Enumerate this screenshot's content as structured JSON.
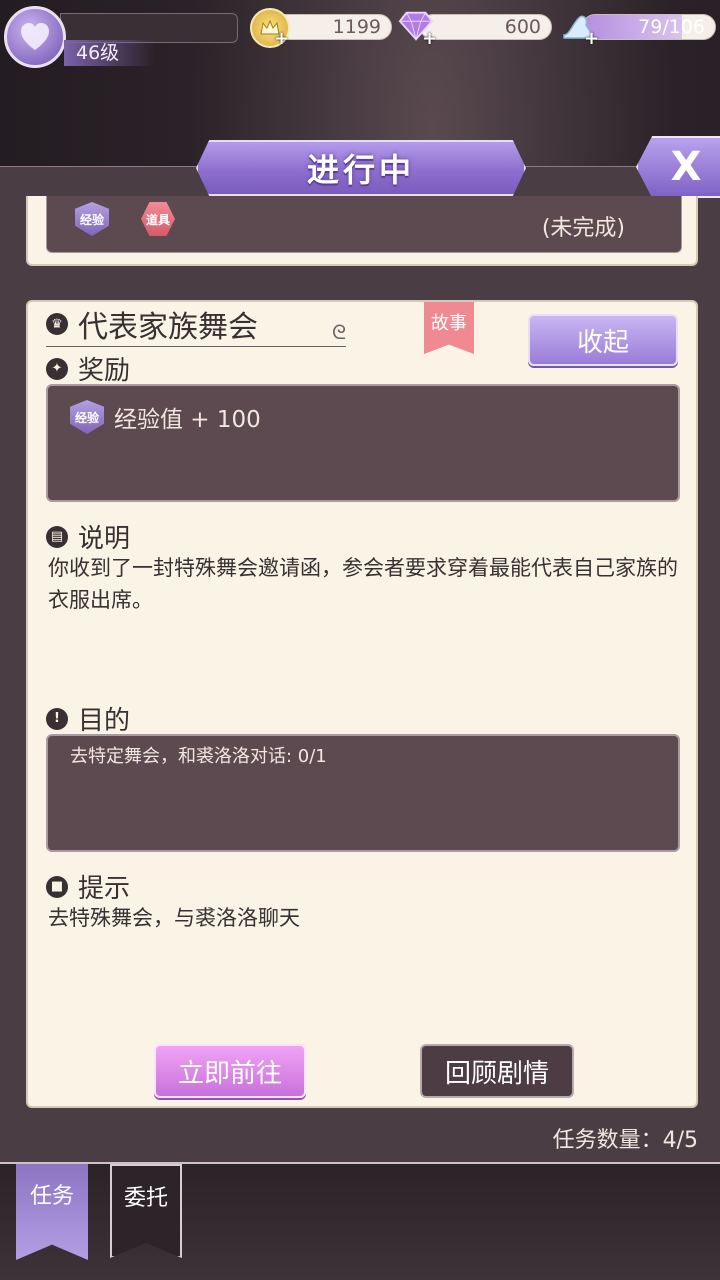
{
  "top_bar": {
    "level": "46级",
    "gold": "1199",
    "diamonds": "600",
    "energy": "79/106",
    "energy_fill": 0.745,
    "plus": "+"
  },
  "header": {
    "title": "进行中",
    "close": "X"
  },
  "prev_quest": {
    "badge_exp": "经验",
    "badge_item": "道具",
    "status": "(未完成)"
  },
  "quest": {
    "title": "代表家族舞会",
    "tag": "故事",
    "collapse": "收起",
    "reward_heading": "奖励",
    "reward_badge": "经验",
    "reward_text": "经验值 + 100",
    "desc_heading": "说明",
    "desc_text": "你收到了一封特殊舞会邀请函，参会者要求穿着最能代表自己家族的衣服出席。",
    "goal_heading": "目的",
    "goal_text": "去特定舞会，和裘洛洛对话: 0/1",
    "hint_heading": "提示",
    "hint_text": "去特殊舞会，与裘洛洛聊天",
    "go_button": "立即前往",
    "review_button": "回顾剧情"
  },
  "task_count": "任务数量：4/5",
  "tabs": [
    {
      "label": "任务"
    },
    {
      "label": "委托"
    }
  ],
  "colors": {
    "accent_purple": "#8e6fcf",
    "card_bg": "#fbf4e6",
    "dark_box": "#5d4a50",
    "story_tag": "#ef8a93"
  }
}
